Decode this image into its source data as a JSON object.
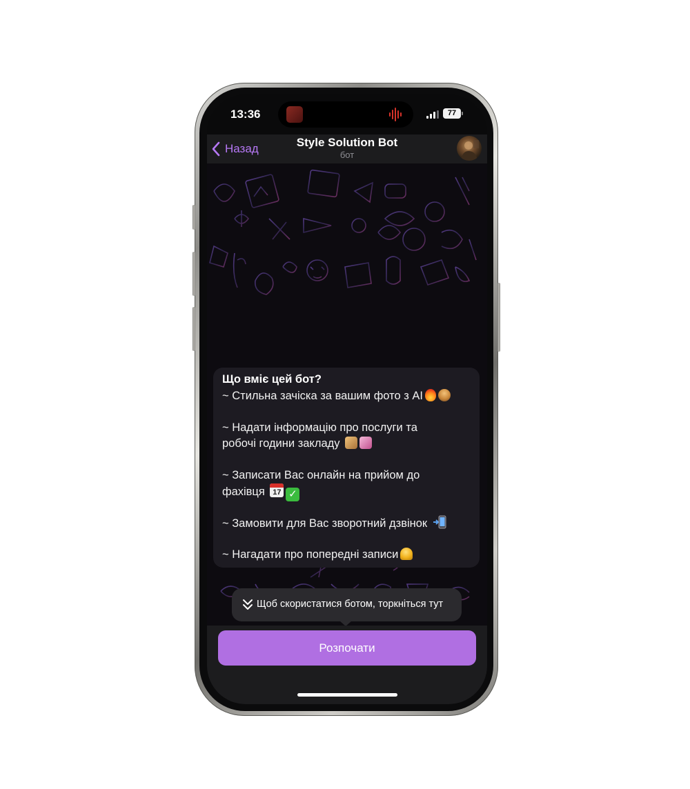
{
  "status_bar": {
    "time": "13:36",
    "battery": "77"
  },
  "header": {
    "back_label": "Назад",
    "title": "Style Solution Bot",
    "subtitle": "бот"
  },
  "message": {
    "title": "Що вміє цей бот?",
    "lines": [
      "~ Стильна зачіска за вашим фото з AI",
      "~ Надати інформацію про послуги та",
      "робочі години закладу",
      "~ Записати Вас онлайн на прийом до",
      "фахівця",
      "~ Замовити для Вас зворотний дзвінок",
      "~ Нагадати про попередні записи"
    ],
    "calendar_day": "17"
  },
  "tooltip": {
    "text": "Щоб скористатися ботом, торкніться тут"
  },
  "start_button": {
    "label": "Розпочати"
  },
  "colors": {
    "accent": "#b678f5",
    "button": "#b06fe2",
    "bubble": "#1d1b22",
    "header": "#1c1c1e",
    "chat_background": "#0d0b10"
  }
}
